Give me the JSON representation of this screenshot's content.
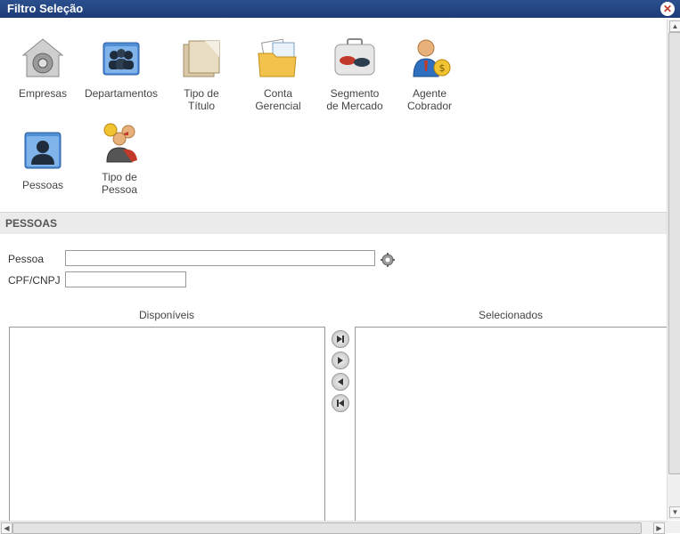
{
  "window": {
    "title": "Filtro Seleção"
  },
  "icons": [
    {
      "label": "Empresas"
    },
    {
      "label": "Departamentos"
    },
    {
      "label": "Tipo de\nTítulo"
    },
    {
      "label": "Conta\nGerencial"
    },
    {
      "label": "Segmento\nde Mercado"
    },
    {
      "label": "Agente\nCobrador"
    },
    {
      "label": "Pessoas"
    },
    {
      "label": "Tipo de\nPessoa"
    }
  ],
  "section": {
    "title": "PESSOAS"
  },
  "form": {
    "pessoa_label": "Pessoa",
    "pessoa_value": "",
    "cpf_label": "CPF/CNPJ",
    "cpf_value": ""
  },
  "lists": {
    "available_header": "Disponíveis",
    "selected_header": "Selecionados"
  }
}
